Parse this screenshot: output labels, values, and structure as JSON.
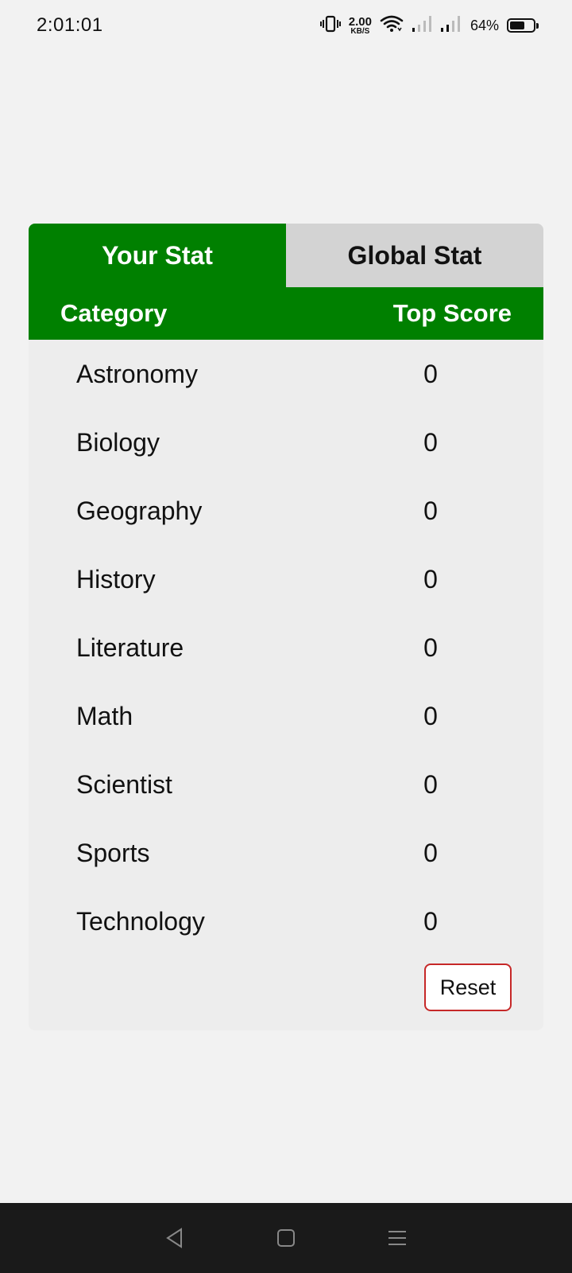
{
  "status_bar": {
    "time": "2:01:01",
    "net_speed_value": "2.00",
    "net_speed_unit": "KB/S",
    "battery_percent": "64%",
    "battery_level": 0.64
  },
  "tabs": [
    {
      "label": "Your Stat",
      "active": true
    },
    {
      "label": "Global Stat",
      "active": false
    }
  ],
  "table": {
    "headers": {
      "category": "Category",
      "score": "Top Score"
    },
    "rows": [
      {
        "category": "Astronomy",
        "score": "0"
      },
      {
        "category": "Biology",
        "score": "0"
      },
      {
        "category": "Geography",
        "score": "0"
      },
      {
        "category": "History",
        "score": "0"
      },
      {
        "category": "Literature",
        "score": "0"
      },
      {
        "category": "Math",
        "score": "0"
      },
      {
        "category": "Scientist",
        "score": "0"
      },
      {
        "category": "Sports",
        "score": "0"
      },
      {
        "category": "Technology",
        "score": "0"
      }
    ]
  },
  "reset_label": "Reset",
  "colors": {
    "accent_green": "#008000",
    "inactive_tab": "#d3d3d3",
    "reset_border": "#c62828"
  },
  "nav_bar": {
    "icons": [
      "back-icon",
      "home-icon",
      "menu-icon"
    ]
  }
}
